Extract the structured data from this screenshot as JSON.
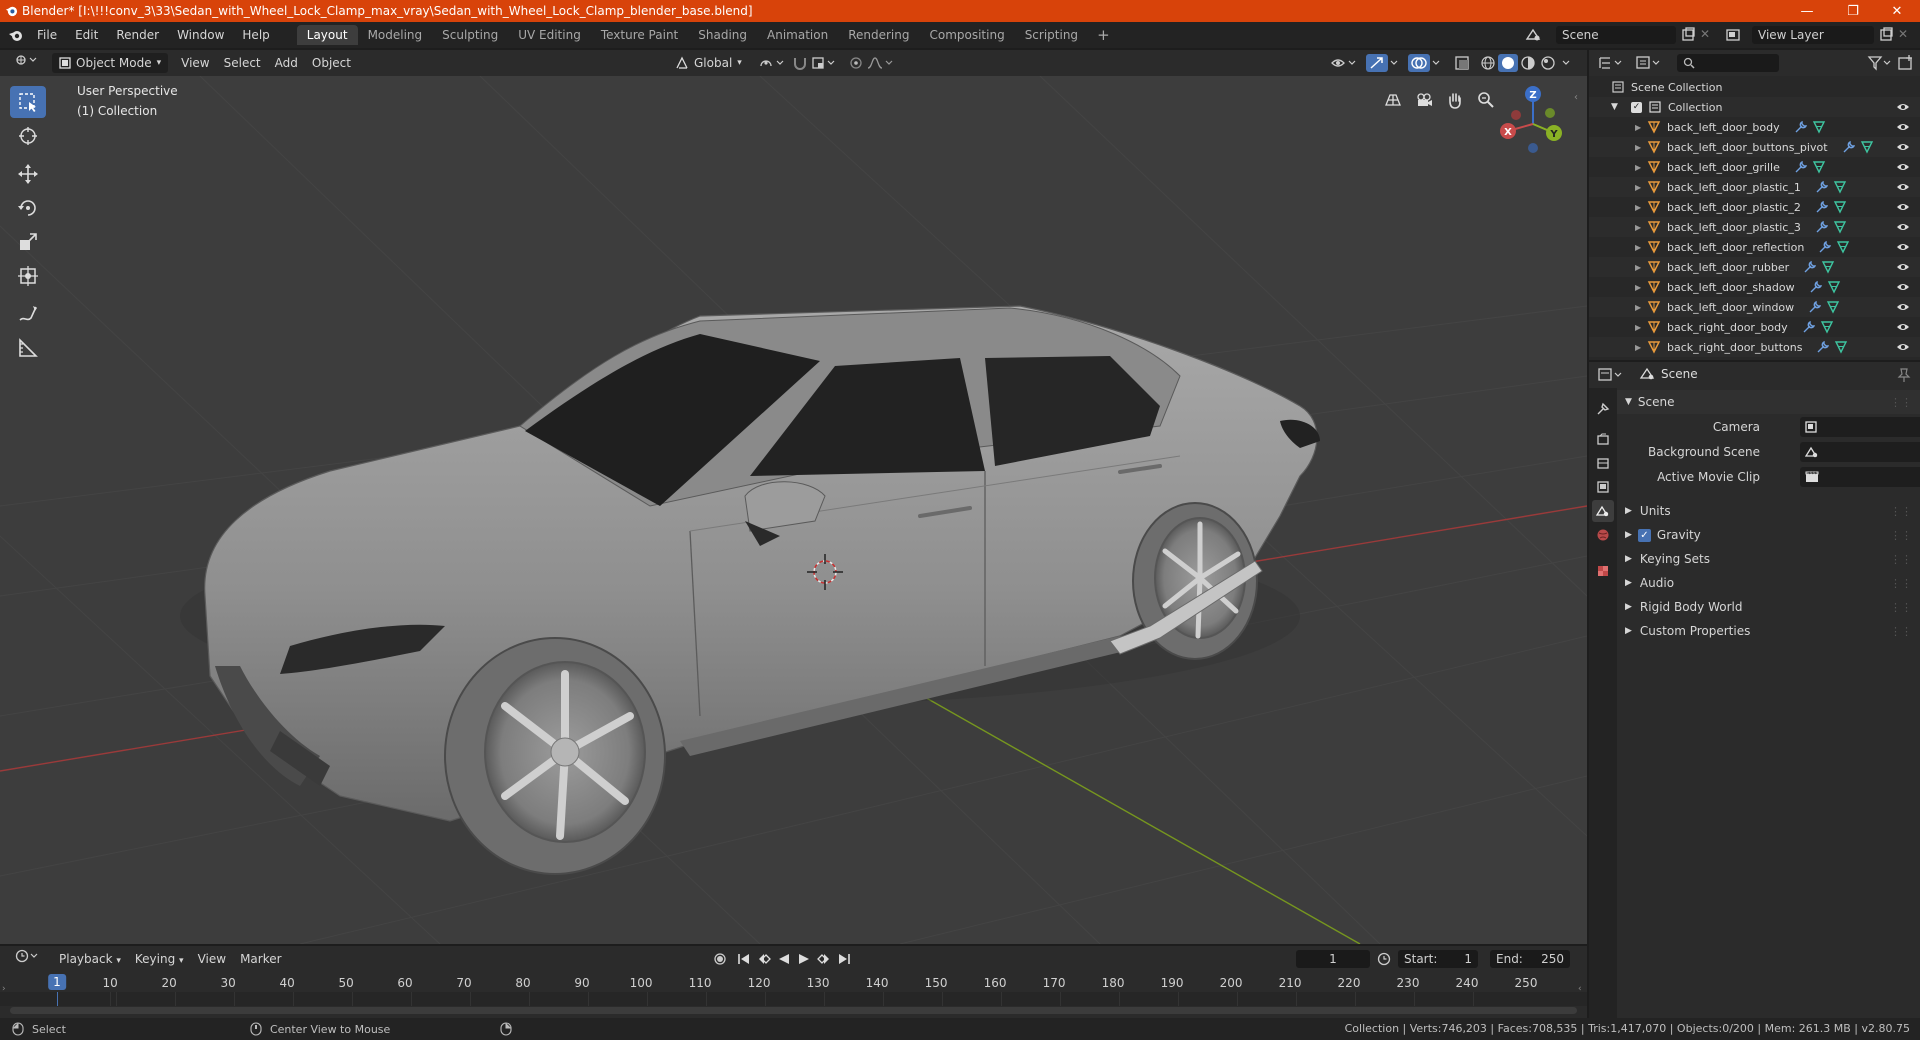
{
  "window": {
    "title": "Blender* [I:\\!!!conv_3\\33\\Sedan_with_Wheel_Lock_Clamp_max_vray\\Sedan_with_Wheel_Lock_Clamp_blender_base.blend]",
    "minimize": "—",
    "maximize": "❐",
    "close": "✕"
  },
  "menubar": {
    "items": [
      "File",
      "Edit",
      "Render",
      "Window",
      "Help"
    ],
    "workspaces": [
      "Layout",
      "Modeling",
      "Sculpting",
      "UV Editing",
      "Texture Paint",
      "Shading",
      "Animation",
      "Rendering",
      "Compositing",
      "Scripting"
    ],
    "active_workspace": "Layout",
    "add_workspace": "+",
    "scene_value": "Scene",
    "view_layer_value": "View Layer"
  },
  "viewport_header": {
    "mode": "Object Mode",
    "menus": [
      "View",
      "Select",
      "Add",
      "Object"
    ],
    "orientation": "Global"
  },
  "viewport": {
    "perspective": "User Perspective",
    "collection": "(1) Collection",
    "gizmo": {
      "x": "X",
      "y": "Y",
      "z": "Z"
    }
  },
  "outliner": {
    "search_placeholder": "",
    "root": "Scene Collection",
    "collection": "Collection",
    "objects": [
      "back_left_door_body",
      "back_left_door_buttons_pivot",
      "back_left_door_grille",
      "back_left_door_plastic_1",
      "back_left_door_plastic_2",
      "back_left_door_plastic_3",
      "back_left_door_reflection",
      "back_left_door_rubber",
      "back_left_door_shadow",
      "back_left_door_window",
      "back_right_door_body",
      "back_right_door_buttons"
    ]
  },
  "properties": {
    "context": "Scene",
    "panel_title": "Scene",
    "fields": [
      {
        "label": "Camera"
      },
      {
        "label": "Background Scene"
      },
      {
        "label": "Active Movie Clip"
      }
    ],
    "sections": [
      "Units",
      "Gravity",
      "Keying Sets",
      "Audio",
      "Rigid Body World",
      "Custom Properties"
    ],
    "gravity_checked": true
  },
  "timeline": {
    "menus": [
      "Playback",
      "Keying",
      "View",
      "Marker"
    ],
    "current_frame": "1",
    "start_label": "Start:",
    "start_value": "1",
    "end_label": "End:",
    "end_value": "250",
    "ruler": [
      "1",
      "10",
      "20",
      "30",
      "40",
      "50",
      "60",
      "70",
      "80",
      "90",
      "100",
      "110",
      "120",
      "130",
      "140",
      "150",
      "160",
      "170",
      "180",
      "190",
      "200",
      "210",
      "220",
      "230",
      "240",
      "250"
    ]
  },
  "statusbar": {
    "select": "Select",
    "center_view": "Center View to Mouse",
    "stats": "Collection | Verts:746,203 | Faces:708,535 | Tris:1,417,070 | Objects:0/200 | Mem: 261.3 MB | v2.80.75"
  },
  "colors": {
    "title_bar": "#d8430a",
    "accent": "#4772b3",
    "viewport_bg": "#3d3d3d",
    "x_axis": "#a83a3a",
    "y_axis": "#7a9a26"
  }
}
